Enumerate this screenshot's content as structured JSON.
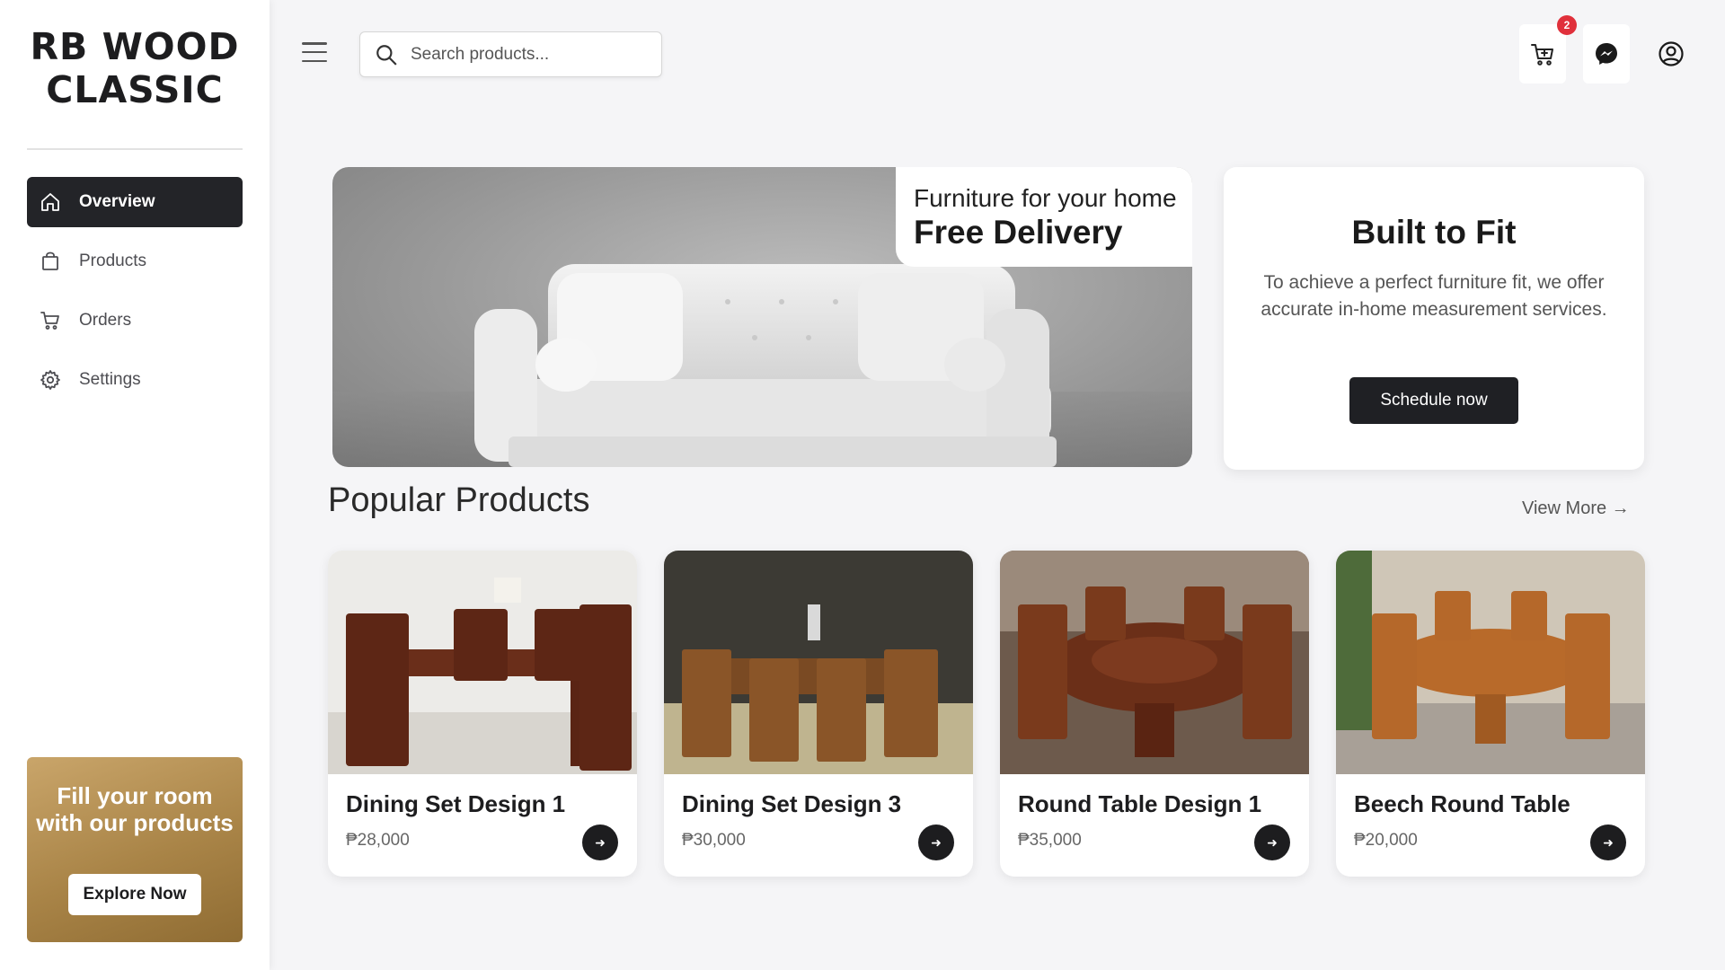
{
  "brand": {
    "line1": "RB WOOD",
    "line2": "CLASSIC"
  },
  "nav": [
    {
      "label": "Overview",
      "icon": "home-icon",
      "active": true
    },
    {
      "label": "Products",
      "icon": "bag-icon",
      "active": false
    },
    {
      "label": "Orders",
      "icon": "cart-icon",
      "active": false
    },
    {
      "label": "Settings",
      "icon": "gear-icon",
      "active": false
    }
  ],
  "promo": {
    "title": "Fill your room with our products",
    "button": "Explore Now"
  },
  "search": {
    "placeholder": "Search products..."
  },
  "topbar": {
    "cart_badge": "2",
    "icons": [
      "cart-icon",
      "messenger-icon",
      "user-icon"
    ]
  },
  "hero": {
    "subtitle": "Furniture for your home",
    "title": "Free Delivery"
  },
  "fit": {
    "title": "Built to Fit",
    "text": "To achieve a perfect furniture fit, we offer accurate in-home measurement services.",
    "button": "Schedule now"
  },
  "popular": {
    "title": "Popular Products",
    "view_more": "View More →",
    "products": [
      {
        "name": "Dining Set Design 1",
        "price": "₱28,000"
      },
      {
        "name": "Dining Set Design 3",
        "price": "₱30,000"
      },
      {
        "name": "Round Table Design 1",
        "price": "₱35,000"
      },
      {
        "name": "Beech Round Table",
        "price": "₱20,000"
      }
    ]
  },
  "colors": {
    "dark": "#232428",
    "accent_gold": "#a98447",
    "badge": "#e0303b",
    "background": "#f5f5f7"
  }
}
